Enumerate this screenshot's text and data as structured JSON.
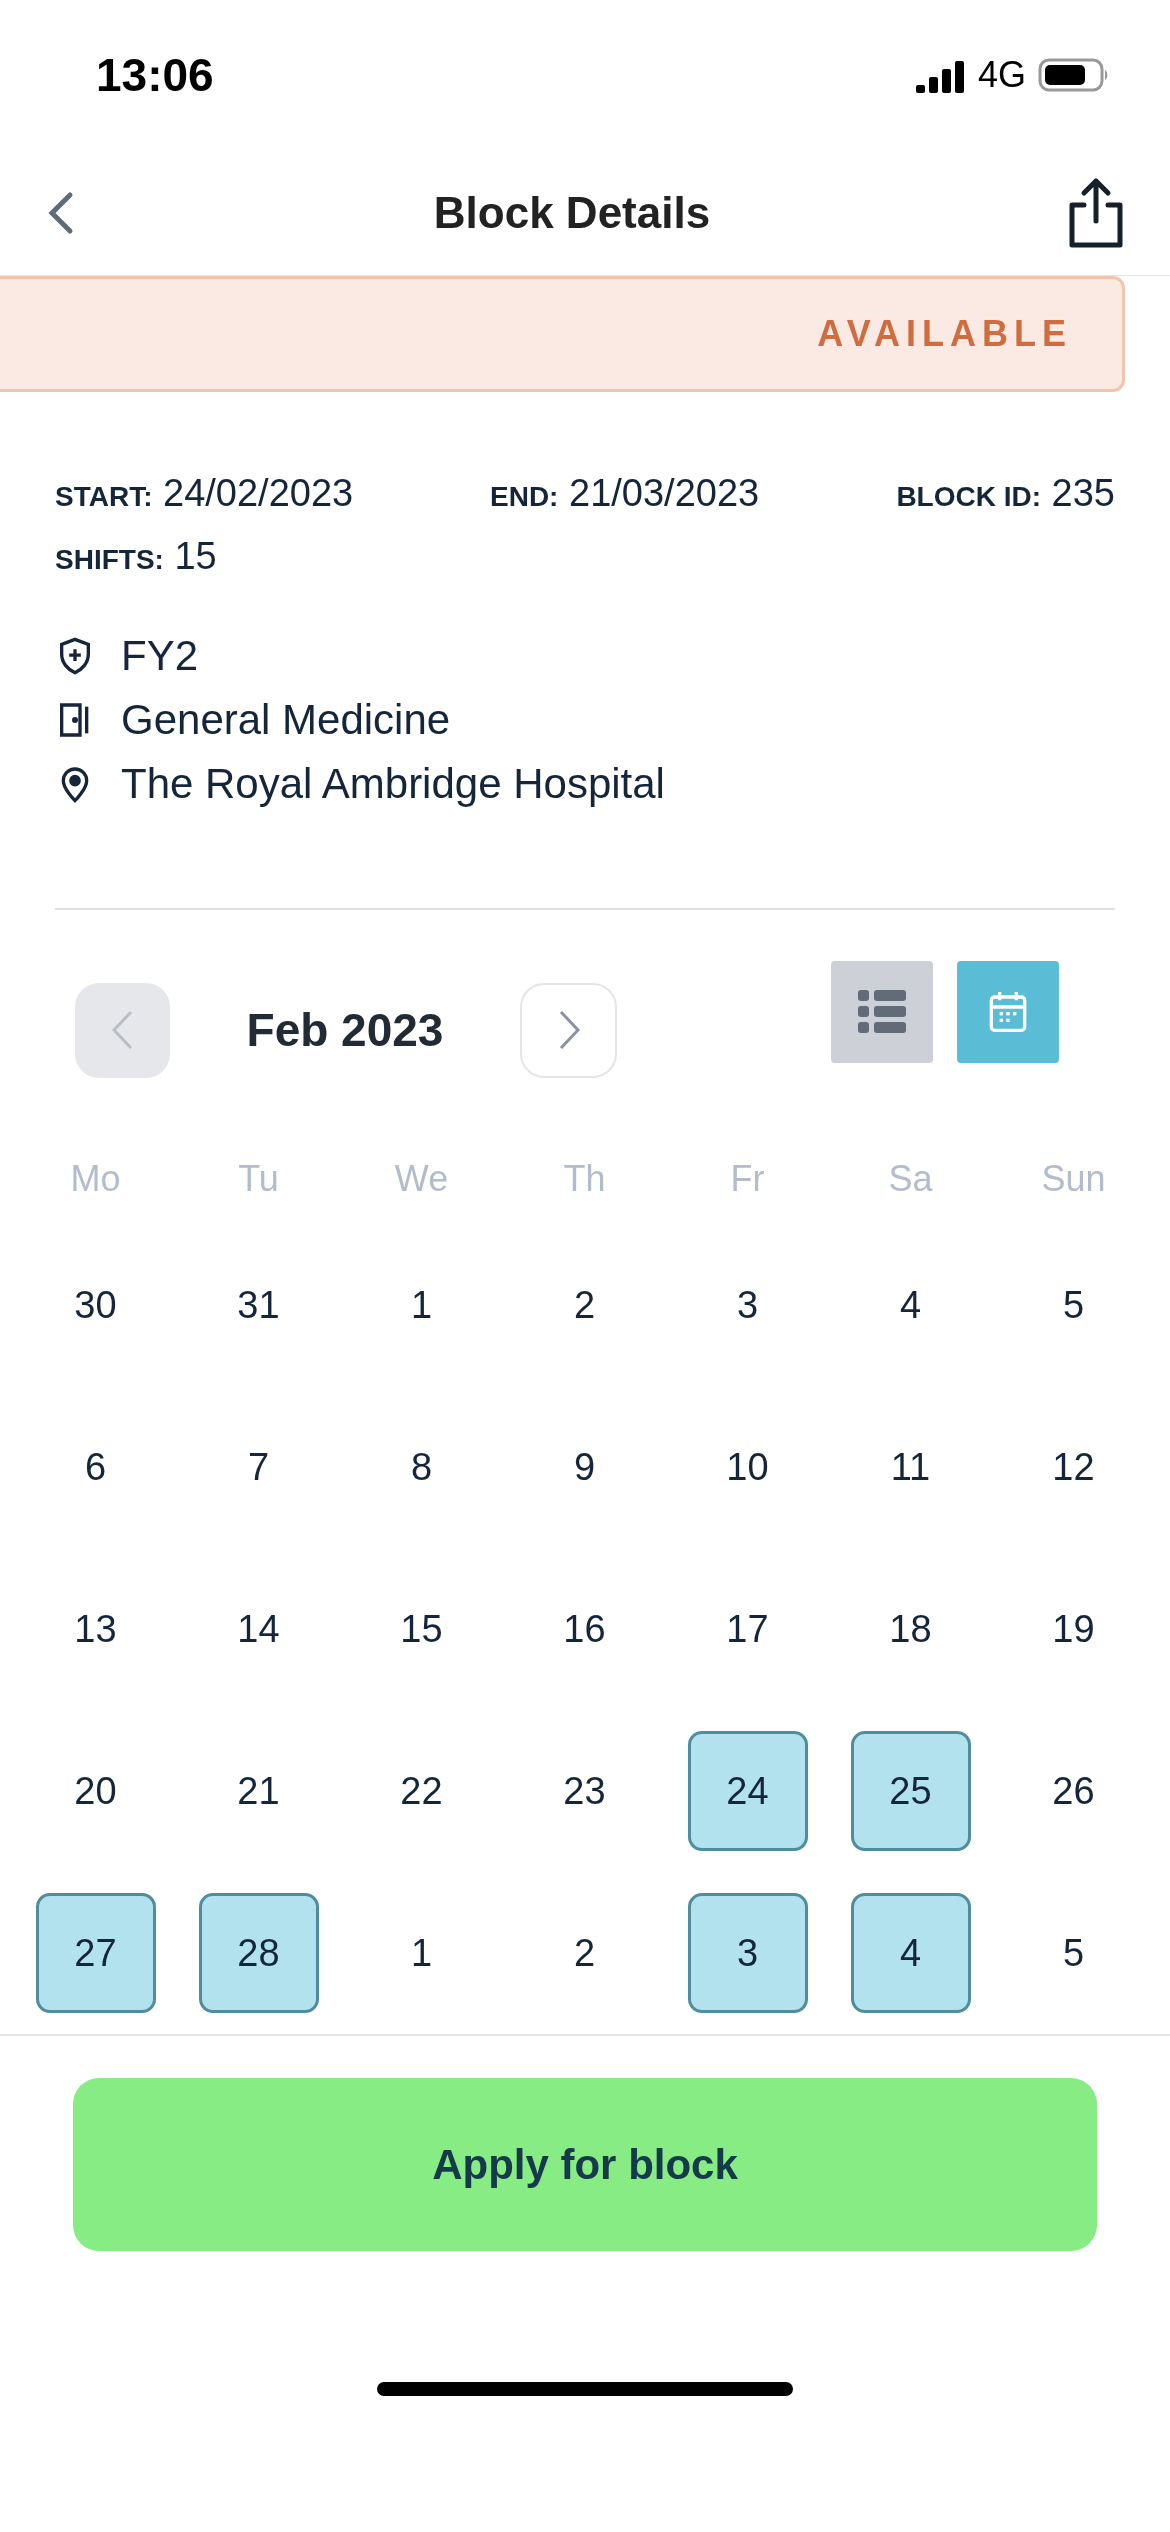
{
  "status_bar": {
    "time": "13:06",
    "network": "4G"
  },
  "header": {
    "title": "Block Details"
  },
  "status_banner": {
    "label": "AVAILABLE"
  },
  "details": [
    {
      "label": "START:",
      "value": "24/02/2023"
    },
    {
      "label": "END:",
      "value": "21/03/2023"
    },
    {
      "label": "BLOCK ID:",
      "value": "235"
    },
    {
      "label": "SHIFTS:",
      "value": "15"
    }
  ],
  "info": [
    {
      "kind": "grade",
      "text": "FY2"
    },
    {
      "kind": "department",
      "text": "General Medicine"
    },
    {
      "kind": "location",
      "text": "The Royal Ambridge Hospital"
    }
  ],
  "calendar": {
    "month": "Feb 2023",
    "prev_disabled": true,
    "views": [
      {
        "kind": "list",
        "selected": false
      },
      {
        "kind": "calendar",
        "selected": true
      }
    ],
    "weekdays": [
      "Mo",
      "Tu",
      "We",
      "Th",
      "Fr",
      "Sa",
      "Sun"
    ],
    "days": [
      {
        "label": "30",
        "selected": false
      },
      {
        "label": "31",
        "selected": false
      },
      {
        "label": "1",
        "selected": false
      },
      {
        "label": "2",
        "selected": false
      },
      {
        "label": "3",
        "selected": false
      },
      {
        "label": "4",
        "selected": false
      },
      {
        "label": "5",
        "selected": false
      },
      {
        "label": "6",
        "selected": false
      },
      {
        "label": "7",
        "selected": false
      },
      {
        "label": "8",
        "selected": false
      },
      {
        "label": "9",
        "selected": false
      },
      {
        "label": "10",
        "selected": false
      },
      {
        "label": "11",
        "selected": false
      },
      {
        "label": "12",
        "selected": false
      },
      {
        "label": "13",
        "selected": false
      },
      {
        "label": "14",
        "selected": false
      },
      {
        "label": "15",
        "selected": false
      },
      {
        "label": "16",
        "selected": false
      },
      {
        "label": "17",
        "selected": false
      },
      {
        "label": "18",
        "selected": false
      },
      {
        "label": "19",
        "selected": false
      },
      {
        "label": "20",
        "selected": false
      },
      {
        "label": "21",
        "selected": false
      },
      {
        "label": "22",
        "selected": false
      },
      {
        "label": "23",
        "selected": false
      },
      {
        "label": "24",
        "selected": true
      },
      {
        "label": "25",
        "selected": true
      },
      {
        "label": "26",
        "selected": false
      },
      {
        "label": "27",
        "selected": true
      },
      {
        "label": "28",
        "selected": true
      },
      {
        "label": "1",
        "selected": false
      },
      {
        "label": "2",
        "selected": false
      },
      {
        "label": "3",
        "selected": true
      },
      {
        "label": "4",
        "selected": true
      },
      {
        "label": "5",
        "selected": false
      }
    ]
  },
  "apply_button": {
    "label": "Apply for block"
  }
}
